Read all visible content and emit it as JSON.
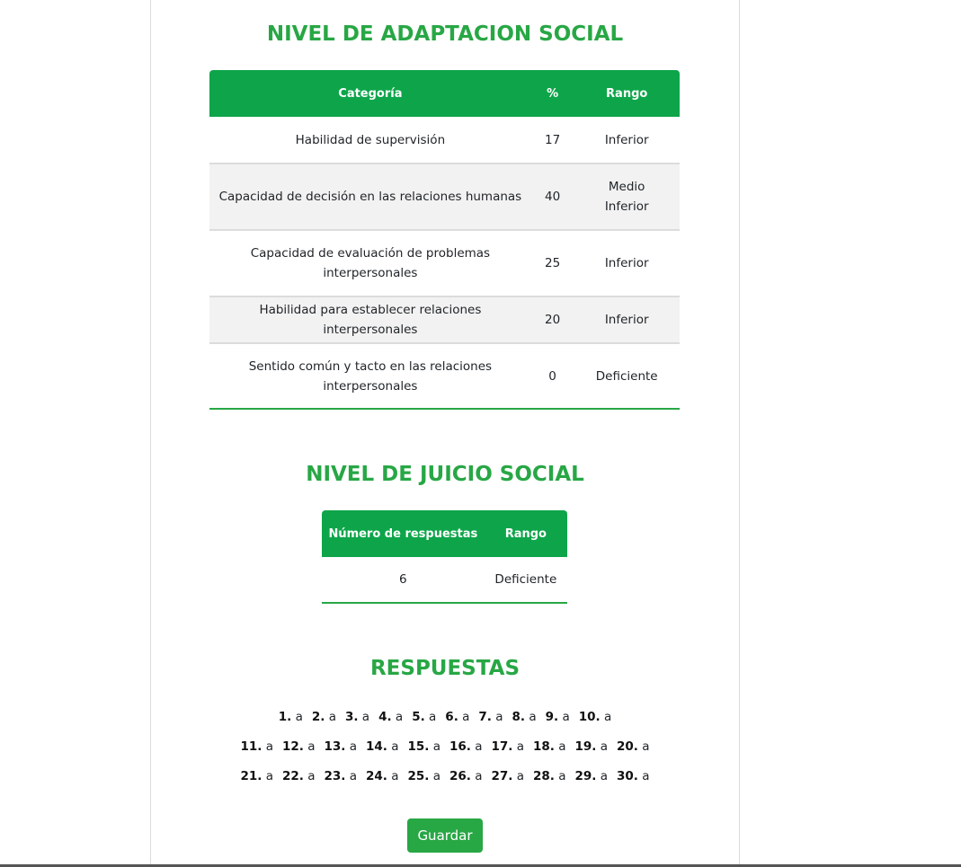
{
  "adaptation": {
    "title": "NIVEL DE ADAPTACION SOCIAL",
    "headers": [
      "Categoría",
      "%",
      "Rango"
    ],
    "rows": [
      {
        "category": "Habilidad de supervisión",
        "percent": "17",
        "range": "Inferior"
      },
      {
        "category": "Capacidad de decisión en las relaciones humanas",
        "percent": "40",
        "range": "Medio Inferior"
      },
      {
        "category": "Capacidad de evaluación de problemas interpersonales",
        "percent": "25",
        "range": "Inferior"
      },
      {
        "category": "Habilidad para establecer relaciones interpersonales",
        "percent": "20",
        "range": "Inferior"
      },
      {
        "category": "Sentido común y tacto en las relaciones interpersonales",
        "percent": "0",
        "range": "Deficiente"
      }
    ]
  },
  "judgment": {
    "title": "NIVEL DE JUICIO SOCIAL",
    "headers": [
      "Número de respuestas",
      "Rango"
    ],
    "row": {
      "count": "6",
      "range": "Deficiente"
    }
  },
  "answers": {
    "title": "RESPUESTAS",
    "rows": [
      [
        {
          "n": "1.",
          "v": "a"
        },
        {
          "n": "2.",
          "v": "a"
        },
        {
          "n": "3.",
          "v": "a"
        },
        {
          "n": "4.",
          "v": "a"
        },
        {
          "n": "5.",
          "v": "a"
        },
        {
          "n": "6.",
          "v": "a"
        },
        {
          "n": "7.",
          "v": "a"
        },
        {
          "n": "8.",
          "v": "a"
        },
        {
          "n": "9.",
          "v": "a"
        },
        {
          "n": "10.",
          "v": "a"
        }
      ],
      [
        {
          "n": "11.",
          "v": "a"
        },
        {
          "n": "12.",
          "v": "a"
        },
        {
          "n": "13.",
          "v": "a"
        },
        {
          "n": "14.",
          "v": "a"
        },
        {
          "n": "15.",
          "v": "a"
        },
        {
          "n": "16.",
          "v": "a"
        },
        {
          "n": "17.",
          "v": "a"
        },
        {
          "n": "18.",
          "v": "a"
        },
        {
          "n": "19.",
          "v": "a"
        },
        {
          "n": "20.",
          "v": "a"
        }
      ],
      [
        {
          "n": "21.",
          "v": "a"
        },
        {
          "n": "22.",
          "v": "a"
        },
        {
          "n": "23.",
          "v": "a"
        },
        {
          "n": "24.",
          "v": "a"
        },
        {
          "n": "25.",
          "v": "a"
        },
        {
          "n": "26.",
          "v": "a"
        },
        {
          "n": "27.",
          "v": "a"
        },
        {
          "n": "28.",
          "v": "a"
        },
        {
          "n": "29.",
          "v": "a"
        },
        {
          "n": "30.",
          "v": "a"
        }
      ]
    ]
  },
  "save_label": "Guardar",
  "colors": {
    "accent": "#28a745",
    "header_bg": "#0ea54a",
    "row_shade": "#f2f2f2"
  }
}
